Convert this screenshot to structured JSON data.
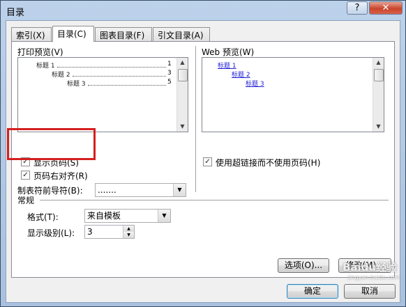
{
  "window": {
    "title": "目录",
    "help_label": "?",
    "close_label": "✕"
  },
  "tabs": [
    {
      "label": "索引(X)"
    },
    {
      "label": "目录(C)"
    },
    {
      "label": "图表目录(F)"
    },
    {
      "label": "引文目录(A)"
    }
  ],
  "print_preview": {
    "label": "打印预览(V)",
    "rows": [
      {
        "text": "标题 1",
        "page": "1"
      },
      {
        "text": "标题 2",
        "page": "3"
      },
      {
        "text": "标题 3",
        "page": "5"
      }
    ]
  },
  "web_preview": {
    "label": "Web 预览(W)",
    "links": [
      "标题 1",
      "标题 2",
      "标题 3"
    ]
  },
  "options": {
    "show_page_numbers": {
      "label": "显示页码(S)",
      "checked": true
    },
    "right_align": {
      "label": "页码右对齐(R)",
      "checked": true
    },
    "use_hyperlinks": {
      "label": "使用超链接而不使用页码(H)",
      "checked": true
    },
    "tab_leader": {
      "label": "制表符前导符(B):",
      "value": "......."
    }
  },
  "general": {
    "section_label": "常规",
    "formats": {
      "label": "格式(T):",
      "value": "来自模板"
    },
    "levels": {
      "label": "显示级别(L):",
      "value": "3"
    }
  },
  "buttons": {
    "options": "选项(O)...",
    "modify": "修改(M)...",
    "ok": "确定",
    "cancel": "取消"
  },
  "watermark": {
    "brand": "Baidu经验",
    "url": "jingyan.baidu.com"
  },
  "check_glyph": "✓",
  "colors": {
    "highlight_box": "#d51f1f",
    "link": "#1c1cd6"
  }
}
